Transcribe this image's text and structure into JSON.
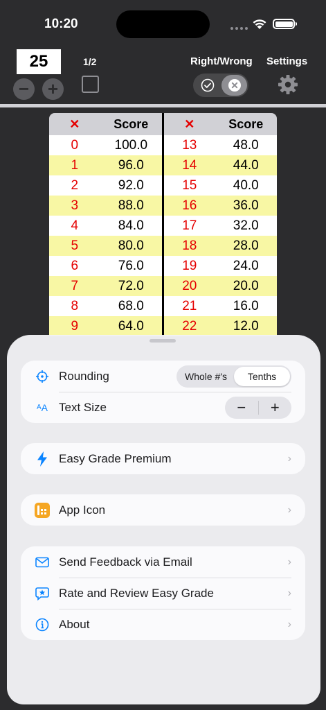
{
  "status": {
    "time": "10:20"
  },
  "toolbar": {
    "count": "25",
    "minus": "−",
    "plus": "+",
    "page": "1/2",
    "right_wrong_label": "Right/Wrong",
    "settings_label": "Settings"
  },
  "table": {
    "headers": {
      "x": "✕",
      "score": "Score"
    },
    "rows": [
      {
        "l_x": "0",
        "l_s": "100.0",
        "r_x": "13",
        "r_s": "48.0"
      },
      {
        "l_x": "1",
        "l_s": "96.0",
        "r_x": "14",
        "r_s": "44.0"
      },
      {
        "l_x": "2",
        "l_s": "92.0",
        "r_x": "15",
        "r_s": "40.0"
      },
      {
        "l_x": "3",
        "l_s": "88.0",
        "r_x": "16",
        "r_s": "36.0"
      },
      {
        "l_x": "4",
        "l_s": "84.0",
        "r_x": "17",
        "r_s": "32.0"
      },
      {
        "l_x": "5",
        "l_s": "80.0",
        "r_x": "18",
        "r_s": "28.0"
      },
      {
        "l_x": "6",
        "l_s": "76.0",
        "r_x": "19",
        "r_s": "24.0"
      },
      {
        "l_x": "7",
        "l_s": "72.0",
        "r_x": "20",
        "r_s": "20.0"
      },
      {
        "l_x": "8",
        "l_s": "68.0",
        "r_x": "21",
        "r_s": "16.0"
      },
      {
        "l_x": "9",
        "l_s": "64.0",
        "r_x": "22",
        "r_s": "12.0"
      }
    ]
  },
  "sheet": {
    "rounding": {
      "label": "Rounding",
      "options": [
        "Whole #'s",
        "Tenths"
      ],
      "selected": "Tenths"
    },
    "text_size": {
      "label": "Text Size",
      "minus": "−",
      "plus": "+"
    },
    "premium": {
      "label": "Easy Grade Premium"
    },
    "app_icon": {
      "label": "App Icon"
    },
    "feedback": {
      "label": "Send Feedback via Email"
    },
    "rate": {
      "label": "Rate and Review Easy Grade"
    },
    "about": {
      "label": "About"
    },
    "chevron": "›"
  },
  "colors": {
    "accent": "#0a84ff",
    "wrong_red": "#e50000",
    "row_yellow": "#f8f7a4",
    "app_icon_orange": "#f5a623"
  }
}
